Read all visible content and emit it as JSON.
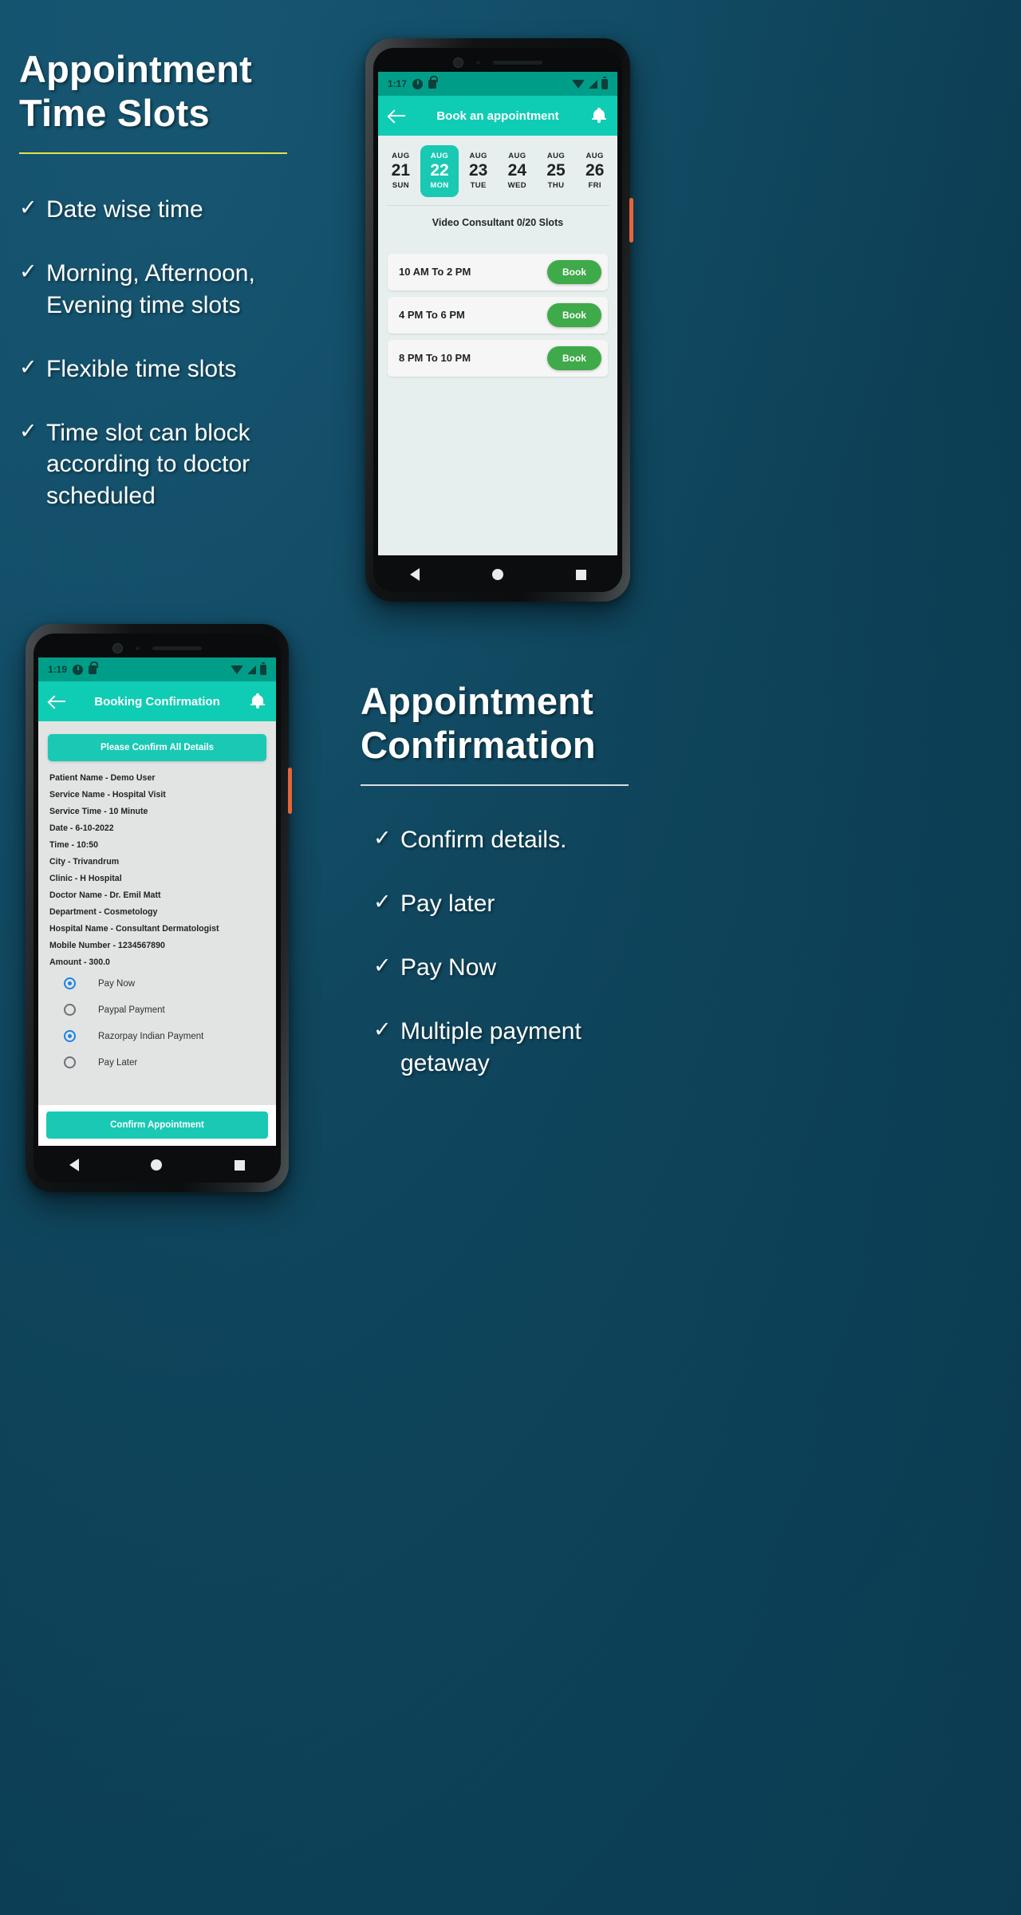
{
  "theme": {
    "background_deep": "#0b3b50",
    "accent_teal": "#19c9b3",
    "statusbar_teal": "#009e89",
    "book_green": "#3eaa49",
    "rule_yellow": "#e8e14a",
    "rule_white": "#d8dde0",
    "radio_blue": "#1b82e8"
  },
  "section_one": {
    "heading_line1": "Appointment",
    "heading_line2": "Time Slots",
    "bullets": [
      {
        "tick": "✓",
        "text": "Date wise time"
      },
      {
        "tick": "✓",
        "text": "Morning, Afternoon, Evening time slots"
      },
      {
        "tick": "✓",
        "text": "Flexible time slots"
      },
      {
        "tick": "✓",
        "text": "Time slot can block according to doctor scheduled"
      }
    ]
  },
  "section_two": {
    "heading_line1": "Appointment",
    "heading_line2": "Confirmation",
    "bullets": [
      {
        "tick": "✓",
        "text": "Confirm details."
      },
      {
        "tick": "✓",
        "text": "Pay later"
      },
      {
        "tick": "✓",
        "text": "Pay Now"
      },
      {
        "tick": "✓",
        "text": "Multiple payment getaway"
      }
    ]
  },
  "phone_booking": {
    "statusbar": {
      "time": "1:17",
      "icons_left": [
        "clock-icon",
        "lock-icon"
      ],
      "icons_right": [
        "wifi-icon",
        "signal-icon",
        "battery-icon"
      ]
    },
    "appbar": {
      "back_icon": "back-arrow-icon",
      "title": "Book an appointment",
      "bell_icon": "bell-icon"
    },
    "dates": [
      {
        "month": "AUG",
        "day": "21",
        "dow": "SUN",
        "selected": false
      },
      {
        "month": "AUG",
        "day": "22",
        "dow": "MON",
        "selected": true
      },
      {
        "month": "AUG",
        "day": "23",
        "dow": "TUE",
        "selected": false
      },
      {
        "month": "AUG",
        "day": "24",
        "dow": "WED",
        "selected": false
      },
      {
        "month": "AUG",
        "day": "25",
        "dow": "THU",
        "selected": false
      },
      {
        "month": "AUG",
        "day": "26",
        "dow": "FRI",
        "selected": false
      }
    ],
    "consultant_line": "Video Consultant 0/20 Slots",
    "slots": [
      {
        "label": "10 AM To 2 PM",
        "button": "Book"
      },
      {
        "label": "4 PM To 6 PM",
        "button": "Book"
      },
      {
        "label": "8 PM To 10 PM",
        "button": "Book"
      }
    ],
    "nav": [
      "back-triangle-icon",
      "home-circle-icon",
      "recents-square-icon"
    ]
  },
  "phone_confirmation": {
    "statusbar": {
      "time": "1:19",
      "icons_left": [
        "clock-icon",
        "lock-icon"
      ],
      "icons_right": [
        "wifi-icon",
        "signal-icon",
        "battery-icon"
      ]
    },
    "appbar": {
      "back_icon": "back-arrow-icon",
      "title": "Booking Confirmation",
      "bell_icon": "bell-icon"
    },
    "banner": "Please Confirm All Details",
    "details": [
      "Patient Name - Demo User",
      "Service Name - Hospital Visit",
      "Service Time - 10 Minute",
      "Date - 6-10-2022",
      "Time - 10:50",
      "City - Trivandrum",
      "Clinic - H Hospital",
      "Doctor Name - Dr. Emil Matt",
      "Department - Cosmetology",
      "Hospital Name - Consultant Dermatologist",
      "Mobile Number - 1234567890",
      "Amount - 300.0"
    ],
    "payment_options": [
      {
        "label": "Pay Now",
        "selected": true
      },
      {
        "label": "Paypal Payment",
        "selected": false
      },
      {
        "label": "Razorpay Indian Payment",
        "selected": true
      },
      {
        "label": "Pay Later",
        "selected": false
      }
    ],
    "confirm_button": "Confirm Appointment",
    "nav": [
      "back-triangle-icon",
      "home-circle-icon",
      "recents-square-icon"
    ]
  }
}
